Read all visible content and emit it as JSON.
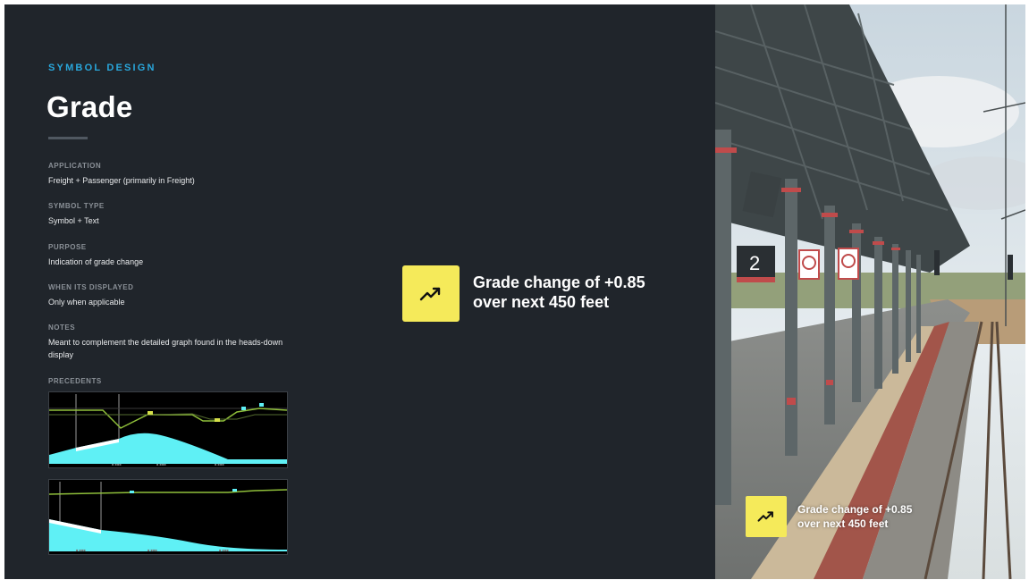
{
  "header": {
    "eyebrow": "SYMBOL DESIGN",
    "title": "Grade"
  },
  "fields": [
    {
      "label": "APPLICATION",
      "value": "Freight + Passenger (primarily in Freight)"
    },
    {
      "label": "SYMBOL TYPE",
      "value": "Symbol + Text"
    },
    {
      "label": "PURPOSE",
      "value": "Indication of grade change"
    },
    {
      "label": "WHEN ITS DISPLAYED",
      "value": "Only when applicable"
    },
    {
      "label": "NOTES",
      "value": "Meant to complement the detailed graph found in the heads-down display"
    }
  ],
  "precedents": {
    "label": "PRECEDENTS"
  },
  "callout": {
    "icon": "trending-up-icon",
    "line1": "Grade change of +0.85",
    "line2": "over next 450 feet"
  },
  "photo": {
    "platform_number": "2"
  },
  "photo_callout": {
    "icon": "trending-up-icon",
    "line1": "Grade change of +0.85",
    "line2": "over next 450 feet"
  },
  "colors": {
    "background": "#20252b",
    "accent": "#29a7dc",
    "badge": "#f5ea5a",
    "profile_fill": "#5ff0f5"
  }
}
